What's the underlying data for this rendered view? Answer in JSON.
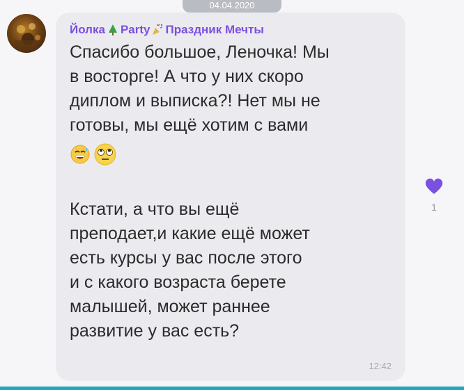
{
  "date_separator": "04.04.2020",
  "message": {
    "sender_parts": [
      "Йолка",
      "Party",
      "Праздник Мечты"
    ],
    "sender_emojis": [
      "tree-icon",
      "party-popper-icon"
    ],
    "paragraph_1": "Спасибо большое, Леночка! Мы\nв восторге! А что у них скоро\nдиплом и выписка?! Нет мы не\nготовы, мы ещё хотим с вами",
    "emojis": [
      "grinning-sweat-face-icon",
      "rolling-eyes-face-icon"
    ],
    "paragraph_2": "Кстати, а что вы ещё\nпреподает,и какие ещё может\nесть курсы у вас после этого\nи с какого возраста берете\nмалышей, может раннее\nразвитие у вас есть?",
    "time": "12:42"
  },
  "reaction": {
    "icon": "heart-icon",
    "count": "1",
    "color": "#7b4fe0"
  },
  "colors": {
    "sender": "#7b4fe0",
    "bubble": "#ebebef",
    "bottom_bar": "#24a7b7"
  }
}
